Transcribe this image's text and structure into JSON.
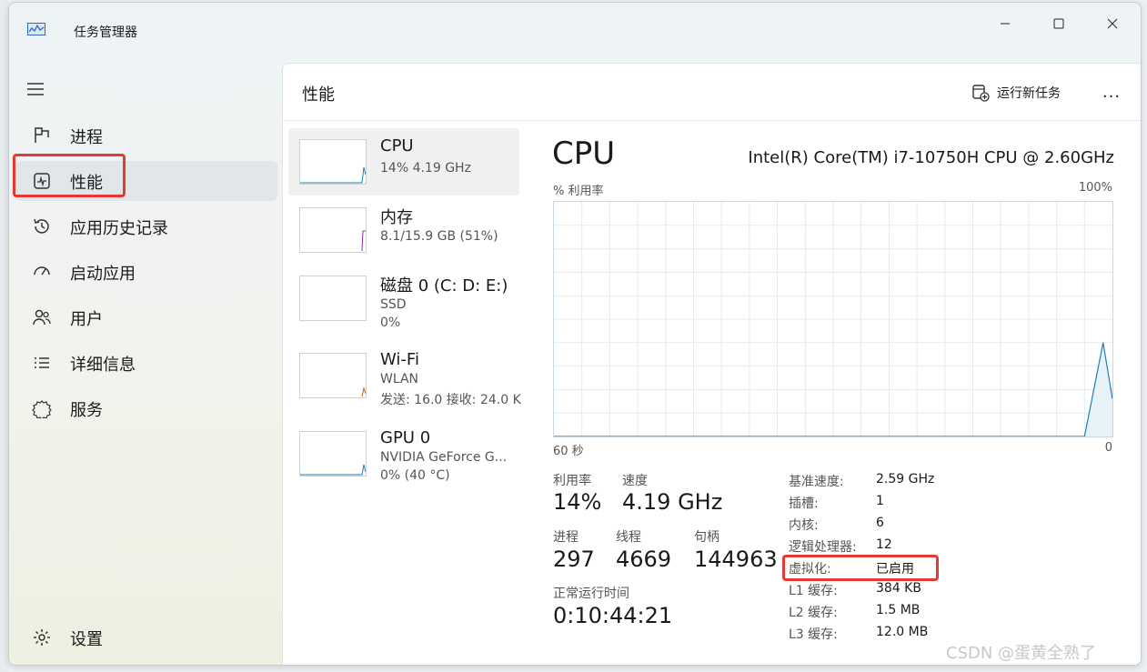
{
  "window": {
    "title": "任务管理器",
    "controls": [
      "minimize-icon",
      "maximize-icon",
      "close-icon"
    ]
  },
  "sidebar": {
    "items": [
      {
        "label": "进程",
        "icon": "processes-icon"
      },
      {
        "label": "性能",
        "icon": "performance-icon",
        "active": true
      },
      {
        "label": "应用历史记录",
        "icon": "history-icon"
      },
      {
        "label": "启动应用",
        "icon": "startup-icon"
      },
      {
        "label": "用户",
        "icon": "users-icon"
      },
      {
        "label": "详细信息",
        "icon": "details-icon"
      },
      {
        "label": "服务",
        "icon": "services-icon"
      }
    ],
    "settings_label": "设置"
  },
  "header": {
    "title": "性能",
    "run_new_task": "运行新任务",
    "more": "..."
  },
  "resources": [
    {
      "name": "CPU",
      "sub": "14%  4.19 GHz",
      "selected": true
    },
    {
      "name": "内存",
      "sub": "8.1/15.9 GB (51%)"
    },
    {
      "name": "磁盘 0 (C: D: E:)",
      "sub": "SSD",
      "sub2": "0%"
    },
    {
      "name": "Wi-Fi",
      "sub": "WLAN",
      "sub2": "发送: 16.0 接收: 24.0 K"
    },
    {
      "name": "GPU 0",
      "sub": "NVIDIA GeForce G...",
      "sub2": "0%  (40 °C)"
    }
  ],
  "detail": {
    "title": "CPU",
    "model": "Intel(R) Core(TM) i7-10750H CPU @ 2.60GHz",
    "y_label": "% 利用率",
    "y_max": "100%",
    "x_left": "60 秒",
    "x_right": "0",
    "stats": {
      "util_label": "利用率",
      "util_value": "14%",
      "speed_label": "速度",
      "speed_value": "4.19 GHz",
      "proc_label": "进程",
      "proc_value": "297",
      "thread_label": "线程",
      "thread_value": "4669",
      "handle_label": "句柄",
      "handle_value": "144963",
      "uptime_label": "正常运行时间",
      "uptime_value": "0:10:44:21"
    },
    "specs": [
      {
        "label": "基准速度:",
        "value": "2.59 GHz"
      },
      {
        "label": "插槽:",
        "value": "1"
      },
      {
        "label": "内核:",
        "value": "6"
      },
      {
        "label": "逻辑处理器:",
        "value": "12"
      },
      {
        "label": "虚拟化:",
        "value": "已启用"
      },
      {
        "label": "L1 缓存:",
        "value": "384 KB"
      },
      {
        "label": "L2 缓存:",
        "value": "1.5 MB"
      },
      {
        "label": "L3 缓存:",
        "value": "12.0 MB"
      }
    ]
  },
  "chart_data": {
    "type": "line",
    "title": "",
    "xlabel": "60 秒",
    "ylabel": "% 利用率",
    "x_range": [
      60,
      0
    ],
    "ylim": [
      0,
      100
    ],
    "grid": true,
    "series": [
      {
        "values_x_seconds_ago": [
          60,
          3,
          1,
          0
        ],
        "values": [
          0,
          0,
          40,
          16
        ]
      }
    ]
  },
  "watermark": "CSDN @蛋黄全熟了"
}
